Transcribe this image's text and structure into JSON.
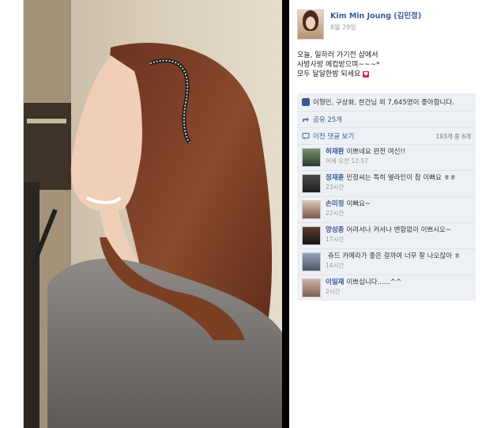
{
  "post": {
    "author": "Kim Min Joung (김민정)",
    "date": "8월 29일",
    "caption_lines": [
      "오늘, 일하러 가기전 샵에서",
      "사방사방 메컵받으며~~~*",
      "모두 달달한밤 되세요"
    ]
  },
  "likes": {
    "text": "이형민, 구상화, 한건님 외 7,645명이 좋아합니다."
  },
  "share": {
    "text": "공유 25개"
  },
  "previous": {
    "label": "이전 댓글 보기",
    "count": "193개 중 6개"
  },
  "comments": [
    {
      "name": "허재환",
      "text": "이쁘네요 완전 여신!!",
      "time": "어제 오전 12:57"
    },
    {
      "name": "정재훈",
      "text": "민정씨는 특히 옆라인이 참 이뻐요 ㅎㅎ",
      "time": "23시간"
    },
    {
      "name": "손미정",
      "text": "이뻐요~",
      "time": "22시간"
    },
    {
      "name": "양성종",
      "text": "어려서나 커서나 변함없이 이쁘시오~",
      "time": "17시간"
    },
    {
      "name": "",
      "text": "쥬드 카메라가 좋은 걸까여 너무 잘 나오잖아 ㅎ",
      "time": "14시간"
    },
    {
      "name": "이일재",
      "text": "이쁘십니다......^^",
      "time": "2시간"
    }
  ],
  "colors": {
    "link": "#3b5998",
    "panel_bg": "#edf0f5",
    "heart": "#d8283e"
  }
}
